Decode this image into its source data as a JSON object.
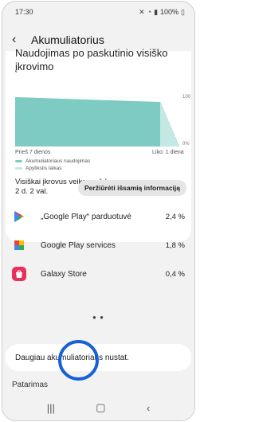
{
  "status": {
    "time": "17:30",
    "battery": "100%"
  },
  "appbar": {
    "title": "Akumuliatorius"
  },
  "usage": {
    "title_line1": "Naudojimas po paskutinio visiško",
    "title_line2": "įkrovimo",
    "y_top": "100",
    "y_bottom": "0%",
    "x_left": "Prieš 7 dienos",
    "x_right": "Liko: 1 diena",
    "legend_usage": "Akumuliatoriaus naudojimas",
    "legend_estimate": "Apytikslis laikas",
    "full_line1": "Visiškai įkrovus veiks maždaug",
    "full_line2": "2 d. 2 val.",
    "detail_button": "Peržiūrėti išsamią informaciją"
  },
  "apps": [
    {
      "name": "„Google Play“ parduotuvė",
      "pct": "2,4 %",
      "icon": "google-play-store-icon"
    },
    {
      "name": "Google Play services",
      "pct": "1,8 %",
      "icon": "google-play-services-icon"
    },
    {
      "name": "Galaxy Store",
      "pct": "0,4 %",
      "icon": "galaxy-store-icon"
    }
  ],
  "more_settings": "Daugiau akumuliatoriaus nustat.",
  "tips_label": "Patarimas",
  "colors": {
    "usage": "#7ecbc4",
    "estimate": "#c4e8e4",
    "highlight": "#1661d6"
  }
}
